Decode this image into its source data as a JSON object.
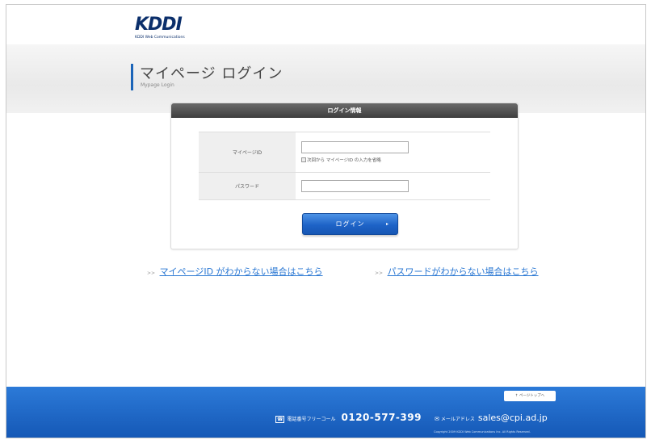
{
  "header": {
    "logo_text": "KDDI",
    "logo_subtext": "KDDI Web Communications"
  },
  "title": {
    "main": "マイページ ログイン",
    "sub": "Mypage Login"
  },
  "login_box": {
    "header": "ログイン情報",
    "id_label": "マイページID",
    "id_value": "",
    "remember_label": "次回から マイページID の入力を省略",
    "remember_checked": false,
    "password_label": "パスワード",
    "password_value": "",
    "login_button": "ログイン",
    "login_button_arrow": "▸"
  },
  "links": {
    "prefix": ">>",
    "forgot_id": "マイページID がわからない場合はこちら",
    "forgot_password": "パスワードがわからない場合はこちら"
  },
  "footer": {
    "pagetop": "↑ ページトップへ",
    "tel_label": "電話番号フリーコール",
    "tel_number": "0120-577-399",
    "mail_label": "メールアドレス",
    "mail_address": "sales@cpi.ad.jp",
    "copyright": "Copyright 2009 KDDI Web Communications Inc. All Rights Reserved."
  },
  "colors": {
    "accent_blue": "#1b64b8",
    "link_blue": "#2b78d3",
    "footer_blue": "#1e66c4",
    "box_header": "#4a4a4a"
  }
}
